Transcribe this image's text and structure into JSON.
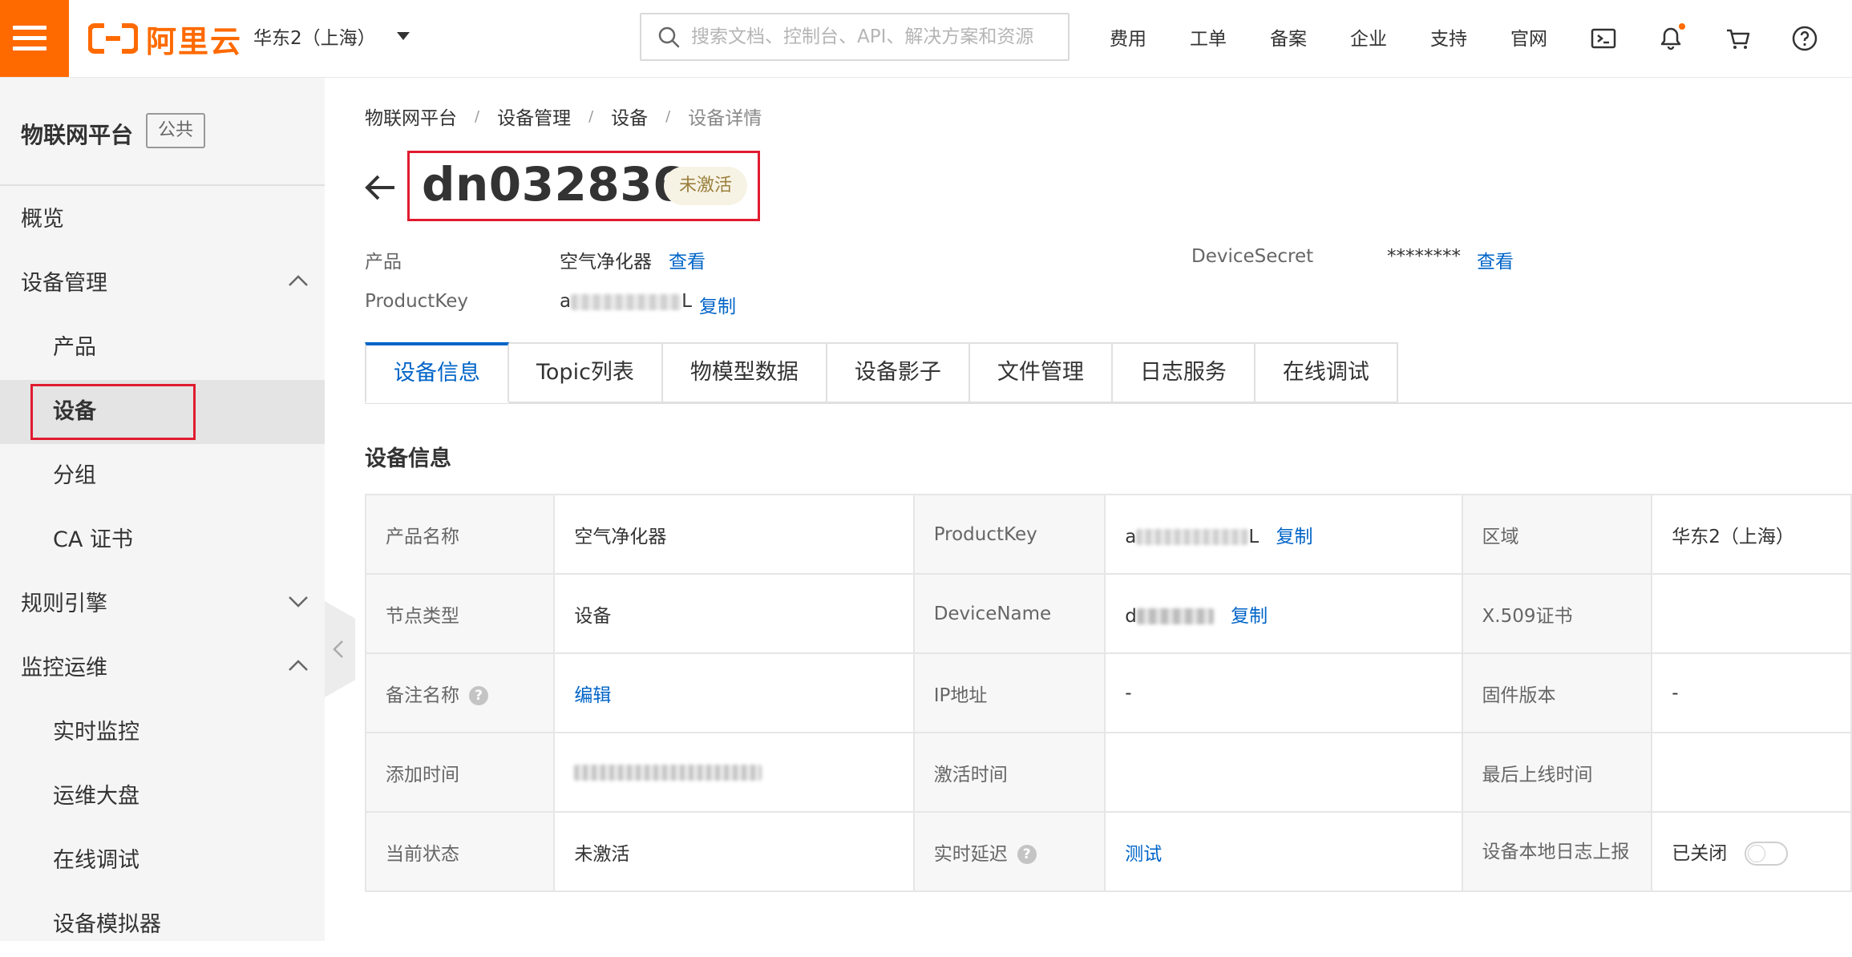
{
  "topbar": {
    "logo_text": "阿里云",
    "region": "华东2（上海）",
    "search_placeholder": "搜索文档、控制台、API、解决方案和资源",
    "nav": [
      "费用",
      "工单",
      "备案",
      "企业",
      "支持",
      "官网"
    ],
    "icons": [
      "terminal-icon",
      "bell-icon",
      "cart-icon",
      "help-circle-icon"
    ],
    "accent": "#ff6a00"
  },
  "sidebar": {
    "title": "物联网平台",
    "badge": "公共",
    "items": [
      {
        "label": "概览",
        "level": 1
      },
      {
        "label": "设备管理",
        "level": 1,
        "expanded": true
      },
      {
        "label": "产品",
        "level": 2
      },
      {
        "label": "设备",
        "level": 2,
        "active": true
      },
      {
        "label": "分组",
        "level": 2
      },
      {
        "label": "CA 证书",
        "level": 2
      },
      {
        "label": "规则引擎",
        "level": 1,
        "expanded": false
      },
      {
        "label": "监控运维",
        "level": 1,
        "expanded": true
      },
      {
        "label": "实时监控",
        "level": 2
      },
      {
        "label": "运维大盘",
        "level": 2
      },
      {
        "label": "在线调试",
        "level": 2
      },
      {
        "label": "设备模拟器",
        "level": 2
      }
    ]
  },
  "breadcrumb": [
    "物联网平台",
    "设备管理",
    "设备",
    "设备详情"
  ],
  "device": {
    "name": "dn032836",
    "status": "未激活",
    "status_color": "#9a7f3d"
  },
  "meta": {
    "product_label": "产品",
    "product_value": "空气净化器",
    "product_link": "查看",
    "secret_label": "DeviceSecret",
    "secret_value": "********",
    "secret_link": "查看",
    "productkey_label": "ProductKey",
    "productkey_prefix": "a",
    "productkey_suffix": "L",
    "productkey_link": "复制"
  },
  "tabs": [
    "设备信息",
    "Topic列表",
    "物模型数据",
    "设备影子",
    "文件管理",
    "日志服务",
    "在线调试"
  ],
  "section_title": "设备信息",
  "info_table": {
    "r1": {
      "l1": "产品名称",
      "v1": "空气净化器",
      "l2": "ProductKey",
      "v2_prefix": "a",
      "v2_suffix": "L",
      "v2_link": "复制",
      "l3": "区域",
      "v3": "华东2（上海）"
    },
    "r2": {
      "l1": "节点类型",
      "v1": "设备",
      "l2": "DeviceName",
      "v2_prefix": "d",
      "v2_link": "复制",
      "l3": "X.509证书",
      "v3": ""
    },
    "r3": {
      "l1": "备注名称",
      "v1_link": "编辑",
      "l2": "IP地址",
      "v2": "-",
      "l3": "固件版本",
      "v3": "-"
    },
    "r4": {
      "l1": "添加时间",
      "l2": "激活时间",
      "v2": "",
      "l3": "最后上线时间",
      "v3": ""
    },
    "r5": {
      "l1": "当前状态",
      "v1": "未激活",
      "l2": "实时延迟",
      "v2_link": "测试",
      "l3": "设备本地日志上报",
      "v3": "已关闭"
    }
  },
  "link_color": "#0064c8",
  "highlight_color": "#e01b2f"
}
